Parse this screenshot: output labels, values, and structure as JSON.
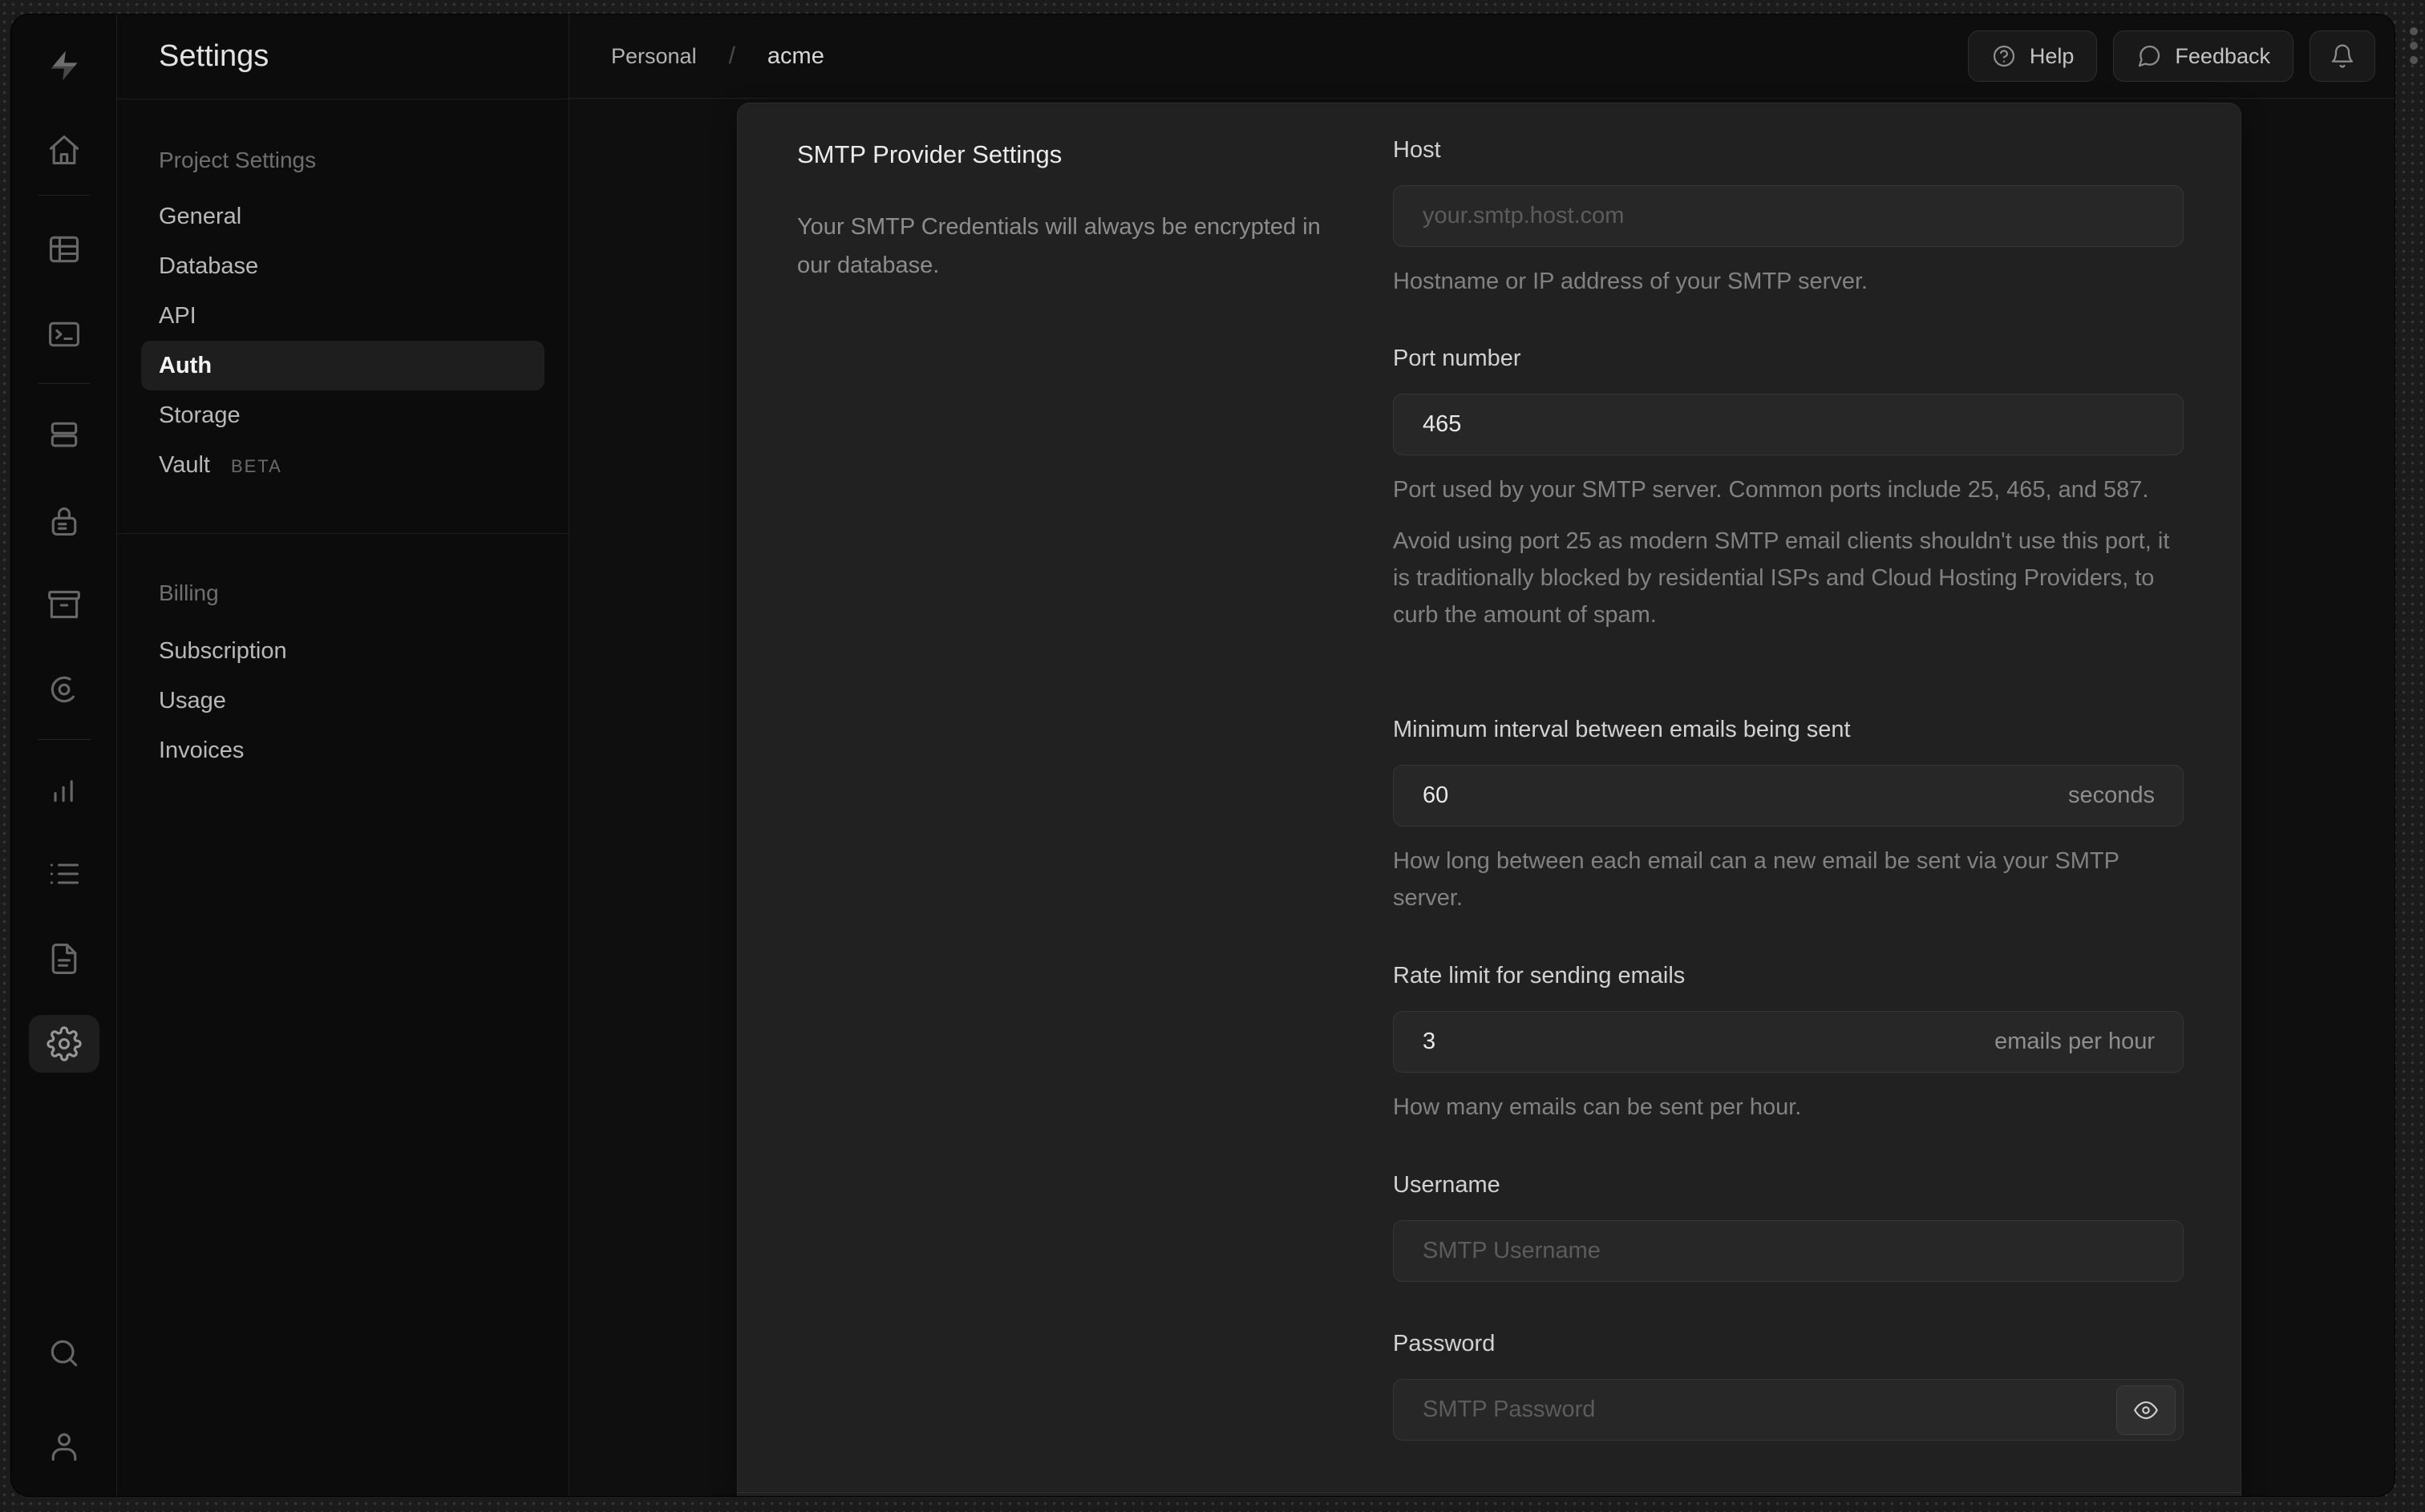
{
  "rail": {
    "items": [
      {
        "icon": "home-icon"
      },
      {
        "icon": "table-editor-icon"
      },
      {
        "icon": "sql-editor-icon"
      },
      {
        "icon": "database-icon"
      },
      {
        "icon": "auth-icon"
      },
      {
        "icon": "storage-icon"
      },
      {
        "icon": "realtime-icon"
      },
      {
        "icon": "reports-icon"
      },
      {
        "icon": "logs-icon"
      },
      {
        "icon": "api-docs-icon"
      },
      {
        "icon": "settings-icon"
      }
    ],
    "bottom_items": [
      {
        "icon": "search-icon"
      },
      {
        "icon": "user-icon"
      }
    ]
  },
  "sidebar": {
    "title": "Settings",
    "sections": [
      {
        "label": "Project Settings",
        "items": [
          {
            "label": "General"
          },
          {
            "label": "Database"
          },
          {
            "label": "API"
          },
          {
            "label": "Auth",
            "active": true
          },
          {
            "label": "Storage"
          },
          {
            "label": "Vault",
            "badge": "BETA"
          }
        ]
      },
      {
        "label": "Billing",
        "items": [
          {
            "label": "Subscription"
          },
          {
            "label": "Usage"
          },
          {
            "label": "Invoices"
          }
        ]
      }
    ]
  },
  "header": {
    "breadcrumb": {
      "org": "Personal",
      "separator": "/",
      "project": "acme"
    },
    "help_label": "Help",
    "feedback_label": "Feedback"
  },
  "panel": {
    "title": "SMTP Provider Settings",
    "description": "Your SMTP Credentials will always be encrypted in our database.",
    "fields": [
      {
        "label": "Host",
        "placeholder": "your.smtp.host.com",
        "helper": "Hostname or IP address of your SMTP server."
      },
      {
        "label": "Port number",
        "value": "465",
        "helper": "Port used by your SMTP server. Common ports include 25, 465, and 587.",
        "note": "Avoid using port 25 as modern SMTP email clients shouldn't use this port, it is traditionally blocked by residential ISPs and Cloud Hosting Providers, to curb the amount of spam."
      },
      {
        "label": "Minimum interval between emails being sent",
        "value": "60",
        "suffix": "seconds",
        "helper": "How long between each email can a new email be sent via your SMTP server."
      },
      {
        "label": "Rate limit for sending emails",
        "value": "3",
        "suffix": "emails per hour",
        "helper": "How many emails can be sent per hour."
      },
      {
        "label": "Username",
        "placeholder": "SMTP Username"
      },
      {
        "label": "Password",
        "placeholder": "SMTP Password"
      }
    ]
  },
  "colors": {
    "card_bg": "#212121",
    "window_bg": "#0c0c0c",
    "input_bg": "#272727",
    "border": "#2d2d2d"
  }
}
